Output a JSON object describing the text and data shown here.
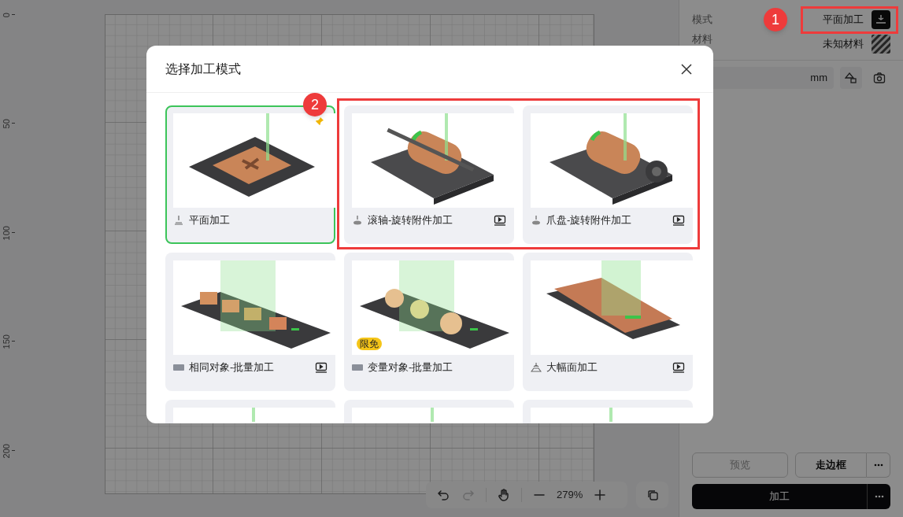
{
  "ruler": {
    "ticks": [
      "0",
      "50",
      "100",
      "150",
      "200"
    ]
  },
  "canvas_toolbar": {
    "zoom": "279%",
    "redo_disabled": true
  },
  "right_panel": {
    "mode_label": "模式",
    "mode_value": "平面加工",
    "material_label": "材料",
    "material_value": "未知材料",
    "unit": "mm",
    "buttons": [
      {
        "label": "预览",
        "kind": "outline",
        "disabled": true
      },
      {
        "label": "走边框",
        "kind": "outline",
        "disabled": false,
        "more": true
      },
      {
        "label": "加工",
        "kind": "primary",
        "disabled": false,
        "more": true
      }
    ]
  },
  "dialog": {
    "title": "选择加工模式",
    "cards": [
      {
        "label": "平面加工",
        "kind": "flat",
        "video": false,
        "selected": true,
        "pinned": true
      },
      {
        "label": "滚轴-旋转附件加工",
        "kind": "roller",
        "video": true,
        "selected": false,
        "pinned": false
      },
      {
        "label": "爪盘-旋转附件加工",
        "kind": "chuck",
        "video": true,
        "selected": false,
        "pinned": false
      },
      {
        "label": "相同对象-批量加工",
        "kind": "batch",
        "video": true,
        "selected": false,
        "pinned": false
      },
      {
        "label": "变量对象-批量加工",
        "kind": "medallion",
        "video": false,
        "selected": false,
        "pinned": false,
        "badge": "限免"
      },
      {
        "label": "大幅面加工",
        "kind": "large",
        "video": true,
        "selected": false,
        "pinned": false
      },
      {
        "kind": "picture",
        "selected": false
      },
      {
        "kind": "picture",
        "selected": false
      },
      {
        "kind": "picture",
        "selected": false
      }
    ]
  },
  "annotations": [
    {
      "label": "1"
    },
    {
      "label": "2"
    }
  ]
}
